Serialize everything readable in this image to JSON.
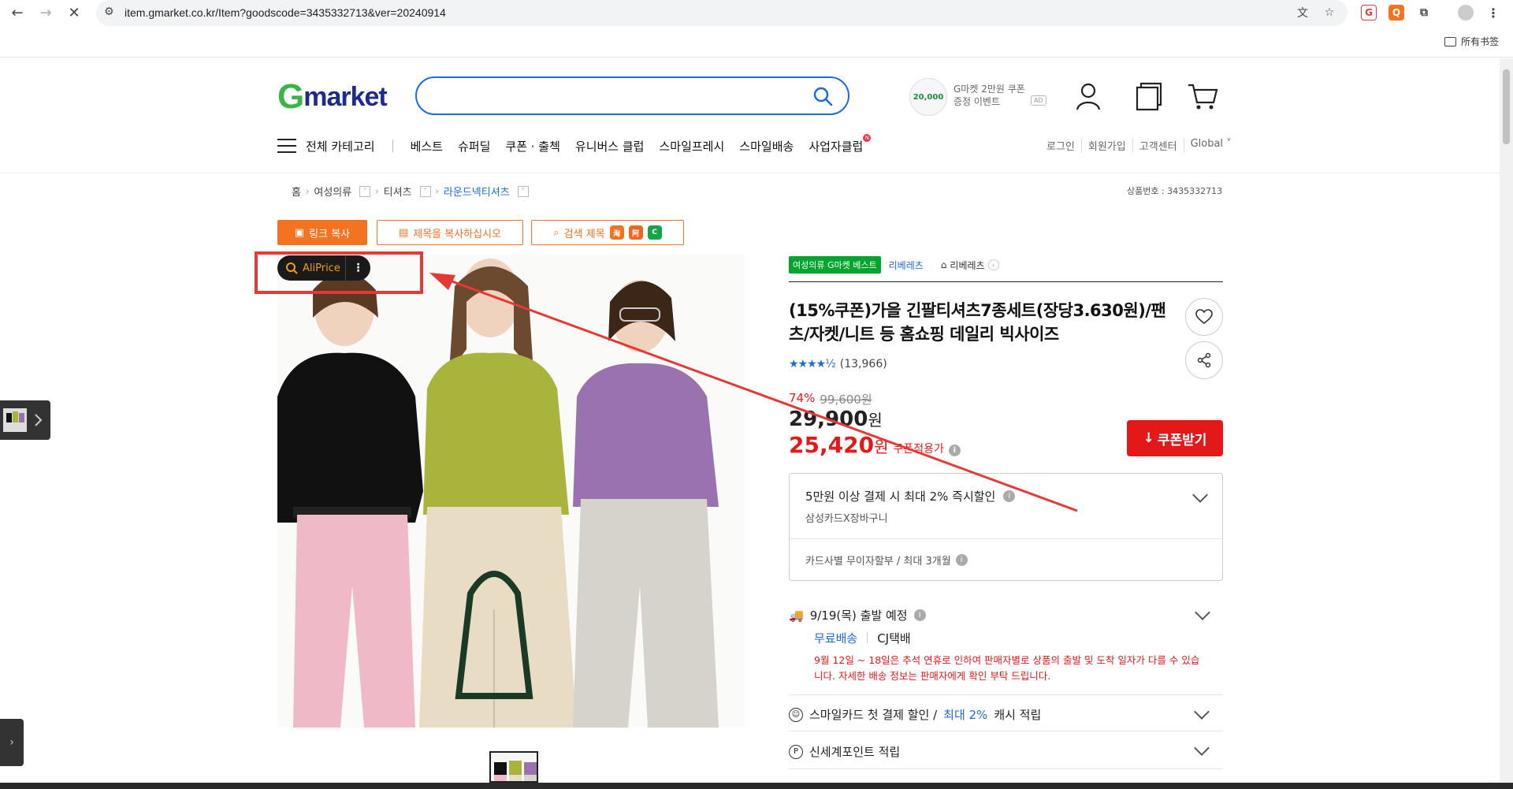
{
  "browser": {
    "url": "item.gmarket.co.kr/Item?goodscode=3435332713&ver=20240914",
    "bookmarks_folder": "所有书签"
  },
  "header": {
    "logo_first": "G",
    "logo_rest": "market",
    "coupon_amount": "20,000",
    "coupon_line1": "G마켓 2만원 쿠폰",
    "coupon_line2": "증정 이벤트",
    "ad_label": "AD",
    "all_category": "전체 카테고리",
    "nav": [
      "베스트",
      "슈퍼딜",
      "쿠폰 · 출첵",
      "유니버스 클럽",
      "스마일프레시",
      "스마일배송",
      "사업자클럽"
    ],
    "nav_badge": "N",
    "util": [
      "로그인",
      "회원가입",
      "고객센터",
      "Global ˅"
    ]
  },
  "breadcrumb": {
    "home": "홈",
    "items": [
      "여성의류",
      "티셔츠",
      "라운드넥티셔츠"
    ],
    "goods_code_label": "상품번호 : 3435332713"
  },
  "actions": {
    "copy_link": "링크 복사",
    "copy_title": "제목을 복사하십시오",
    "search_title": "검색 제목",
    "aliprice": "AliPrice"
  },
  "product": {
    "best_badge": "여성의류 G마켓 베스트",
    "seller": "리베레츠",
    "shop": "리베레츠",
    "title": "(15%쿠폰)가을 긴팔티셔츠7종세트(장당3.630원)/팬츠/자켓/니트 등 홈쇼핑 데일리 빅사이즈",
    "rating": 4.5,
    "review_count": "(13,966)",
    "discount_rate": "74%",
    "original_price": "99,600원",
    "sale_price": "29,900",
    "sale_unit": "원",
    "coupon_price": "25,420",
    "coupon_unit": "원",
    "coupon_price_label": "쿠폰적용가",
    "coupon_button": "쿠폰받기"
  },
  "card_benefit": {
    "title": "5만원 이상 결제 시 최대 2% 즉시할인",
    "sub": "삼성카드X장바구니",
    "installment": "카드사별 무이자할부 / 최대 3개월"
  },
  "shipping": {
    "date": "9/19(목) 출발 예정",
    "free": "무료배송",
    "courier": "CJ택배",
    "notice": "9월 12일 ~ 18일은 추석 연휴로 인하여 판매자별로 상품의 출발 및 도착 일자가 다를 수 있습니다. 자세한 배송 정보는 판매자에게 확인 부탁 드립니다."
  },
  "benefits": {
    "smile_prefix": "스마일카드 첫 결제 할인 /",
    "smile_highlight": "최대 2%",
    "smile_suffix": "캐시 적립",
    "shinsegae": "신세계포인트 적립"
  },
  "colors": {
    "accent_orange": "#f37321",
    "brand_blue": "#1c6cd5",
    "price_red": "#e31919",
    "annotation_red": "#e53935"
  }
}
